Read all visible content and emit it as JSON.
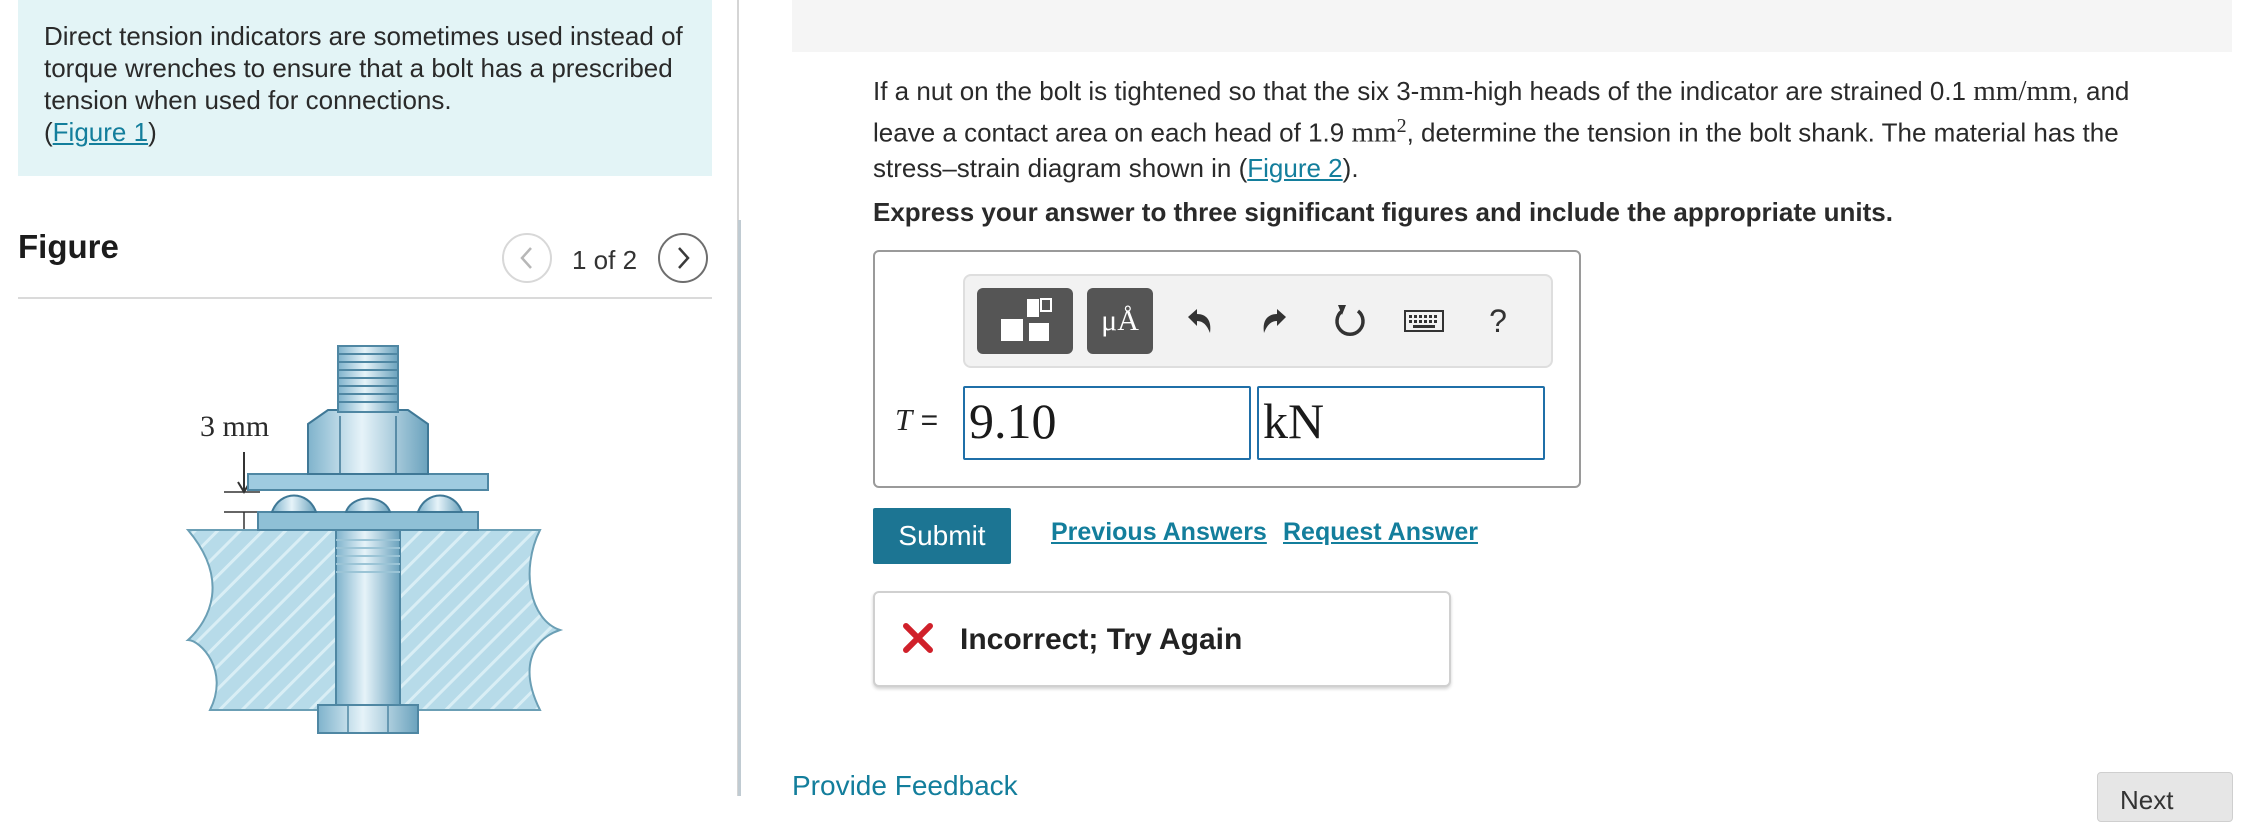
{
  "intro": {
    "text": "Direct tension indicators are sometimes used instead of torque wrenches to ensure that a bolt has a prescribed tension when used for connections.",
    "figure_link_prefix": "(",
    "figure_link": "Figure 1",
    "figure_link_suffix": ")"
  },
  "figure": {
    "header": "Figure",
    "pager_text": "1 of 2",
    "dimension_label": "3 mm",
    "prev_icon": "chevron-left-icon",
    "next_icon": "chevron-right-icon"
  },
  "problem": {
    "p1": "If a nut on the bolt is tightened so that the six 3-",
    "m1": "mm",
    "p2": "-high heads of the indicator are strained 0.1 ",
    "m2": "mm/mm",
    "p3": ", and leave a contact area on each head of 1.9 ",
    "m3": "mm",
    "m3_sup": "2",
    "p4": ", determine the tension in the bolt shank. The material has the stress–strain diagram shown in (",
    "figure_link": "Figure 2",
    "p5": ").",
    "instruction": "Express your answer to three significant figures and include the appropriate units."
  },
  "toolbar": {
    "units_label": "μÅ",
    "help_label": "?",
    "icons": [
      "templates-icon",
      "units-icon",
      "undo-icon",
      "redo-icon",
      "reset-icon",
      "keyboard-icon",
      "help-icon"
    ]
  },
  "answer": {
    "variable": "T",
    "equals": "=",
    "value": "9.10",
    "units": "kN"
  },
  "actions": {
    "submit": "Submit",
    "previous_answers": "Previous Answers",
    "request_answer": "Request Answer"
  },
  "feedback": {
    "message": "Incorrect; Try Again",
    "icon": "x-mark-icon",
    "color": "#d0202a"
  },
  "footer": {
    "provide_feedback": "Provide Feedback",
    "next": "Next"
  },
  "colors": {
    "accent": "#1c7593",
    "link": "#137e9c",
    "intro_bg": "#e3f4f6",
    "error": "#d0202a"
  }
}
